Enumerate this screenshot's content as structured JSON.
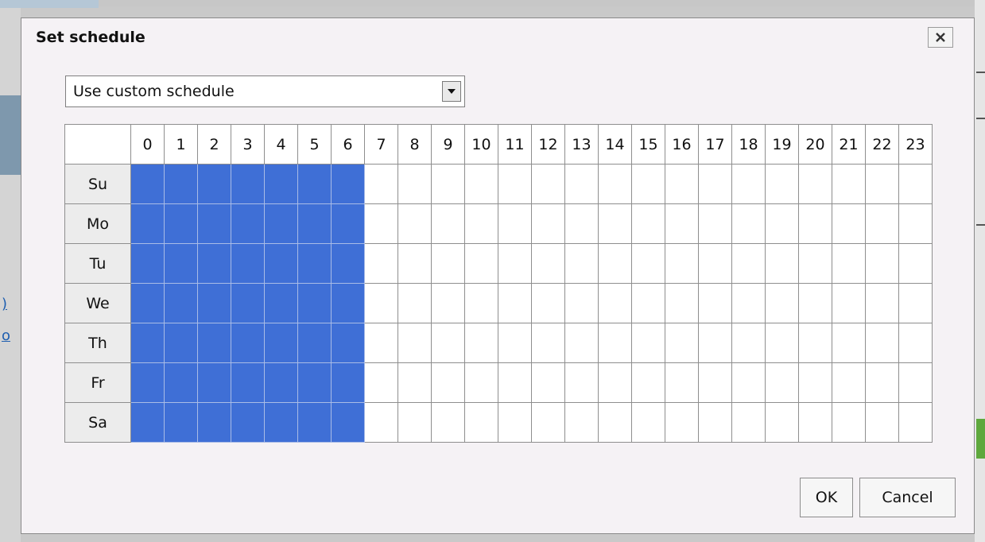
{
  "background": {
    "link_fragments": [
      ")",
      "o"
    ]
  },
  "dialog": {
    "title": "Set schedule",
    "close_icon": "close-icon",
    "schedule_select": {
      "value": "Use custom schedule",
      "arrow_icon": "dropdown-arrow-icon"
    },
    "grid": {
      "hours": [
        "0",
        "1",
        "2",
        "3",
        "4",
        "5",
        "6",
        "7",
        "8",
        "9",
        "10",
        "11",
        "12",
        "13",
        "14",
        "15",
        "16",
        "17",
        "18",
        "19",
        "20",
        "21",
        "22",
        "23"
      ],
      "days": [
        "Su",
        "Mo",
        "Tu",
        "We",
        "Th",
        "Fr",
        "Sa"
      ],
      "active_hours": [
        0,
        1,
        2,
        3,
        4,
        5,
        6
      ],
      "active_color": "#3f6fd6"
    },
    "ok_label": "OK",
    "cancel_label": "Cancel"
  }
}
